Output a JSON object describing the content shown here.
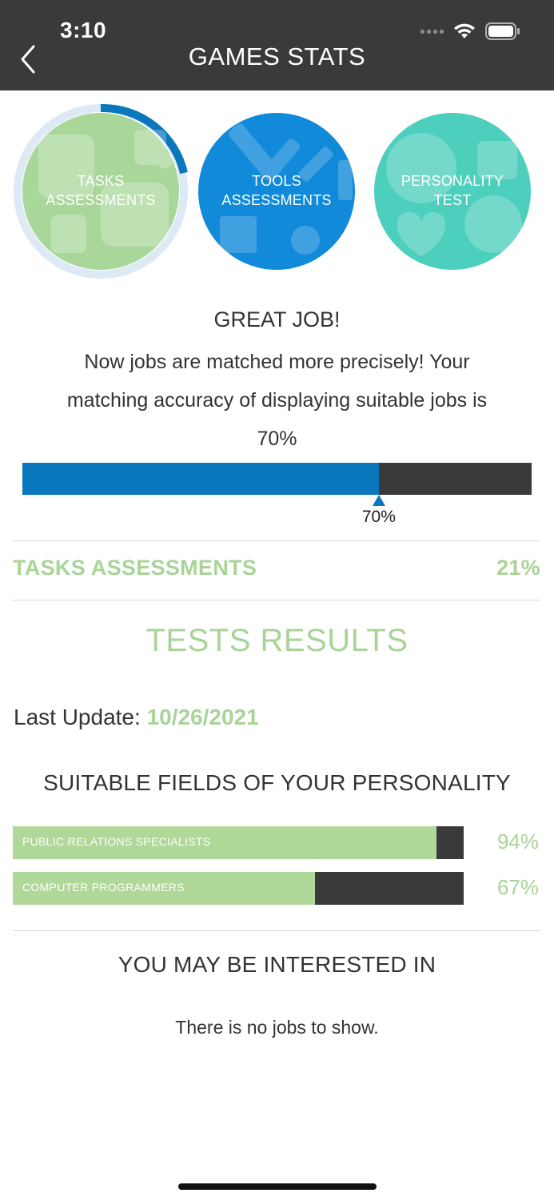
{
  "status_bar": {
    "time": "3:10"
  },
  "header": {
    "title": "GAMES STATS"
  },
  "circles": [
    {
      "line1": "TASKS",
      "line2": "ASSESSMENTS",
      "color": "#a9d79a",
      "selected": true,
      "ring_progress": 0.21
    },
    {
      "line1": "TOOLS",
      "line2": "ASSESSMENTS",
      "color": "#118ad9",
      "selected": false
    },
    {
      "line1": "PERSONALITY",
      "line2": "TEST",
      "color": "#4dcfbd",
      "selected": false
    }
  ],
  "summary": {
    "heading": "GREAT JOB!",
    "line1": "Now jobs are matched more precisely! Your",
    "line2": "matching accuracy of displaying suitable jobs is",
    "line3": "70%",
    "accuracy": 0.7,
    "accuracy_label": "70%"
  },
  "tasks_assessments": {
    "label": "TASKS ASSESSMENTS",
    "value": "21%"
  },
  "tests_results": {
    "title": "TESTS RESULTS",
    "last_update_label": "Last Update:",
    "last_update_date": "10/26/2021"
  },
  "fields": {
    "title": "SUITABLE FIELDS OF YOUR PERSONALITY",
    "items": [
      {
        "label": "PUBLIC RELATIONS SPECIALISTS",
        "percent": 94,
        "percent_label": "94%"
      },
      {
        "label": "COMPUTER PROGRAMMERS",
        "percent": 67,
        "percent_label": "67%"
      }
    ]
  },
  "interested": {
    "title": "YOU MAY BE INTERESTED IN",
    "empty_text": "There is no jobs to show."
  },
  "colors": {
    "header": "#3a3a3a",
    "accent_green": "#a9d498",
    "accent_blue": "#0a77bd"
  }
}
